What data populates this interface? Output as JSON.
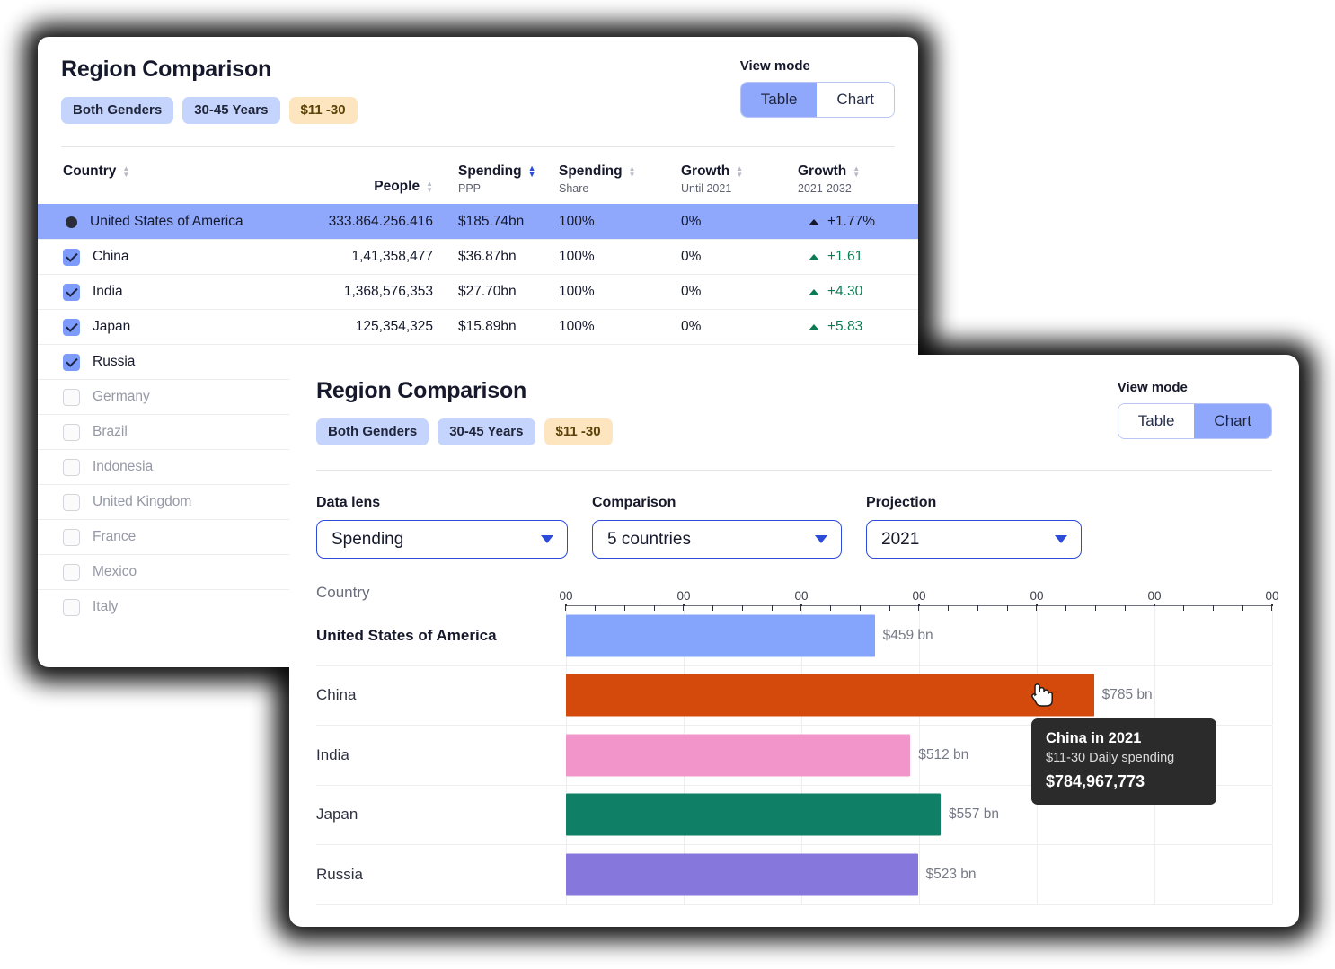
{
  "back_card": {
    "title": "Region Comparison",
    "chips": [
      {
        "label": "Both Genders",
        "style": "blue"
      },
      {
        "label": "30-45 Years",
        "style": "blue"
      },
      {
        "label": "$11 -30",
        "style": "amber"
      }
    ],
    "view_mode": {
      "label": "View mode",
      "options": [
        "Table",
        "Chart"
      ],
      "active": "Table"
    },
    "table": {
      "columns": [
        {
          "title": "Country",
          "sub": "",
          "sorted": false
        },
        {
          "title": "People",
          "sub": "",
          "sorted": false
        },
        {
          "title": "Spending",
          "sub": "PPP",
          "sorted": true
        },
        {
          "title": "Spending",
          "sub": "Share",
          "sorted": false
        },
        {
          "title": "Growth",
          "sub": "Until 2021",
          "sorted": false
        },
        {
          "title": "Growth",
          "sub": "2021-2032",
          "sorted": false
        }
      ],
      "rows": [
        {
          "country": "United States of America",
          "people": "333.864.256.416",
          "spending_ppp": "$185.74bn",
          "spending_share": "100%",
          "growth_until": "0%",
          "growth_future": "+1.77%",
          "state": "selected",
          "marker": "dot"
        },
        {
          "country": "China",
          "people": "1,41,358,477",
          "spending_ppp": "$36.87bn",
          "spending_share": "100%",
          "growth_until": "0%",
          "growth_future": "+1.61",
          "state": "checked",
          "marker": "checkbox-on"
        },
        {
          "country": "India",
          "people": "1,368,576,353",
          "spending_ppp": "$27.70bn",
          "spending_share": "100%",
          "growth_until": "0%",
          "growth_future": "+4.30",
          "state": "checked",
          "marker": "checkbox-on"
        },
        {
          "country": "Japan",
          "people": "125,354,325",
          "spending_ppp": "$15.89bn",
          "spending_share": "100%",
          "growth_until": "0%",
          "growth_future": "+5.83",
          "state": "checked",
          "marker": "checkbox-on"
        },
        {
          "country": "Russia",
          "people": "",
          "spending_ppp": "",
          "spending_share": "",
          "growth_until": "",
          "growth_future": "",
          "state": "checked",
          "marker": "checkbox-on"
        },
        {
          "country": "Germany",
          "people": "",
          "spending_ppp": "",
          "spending_share": "",
          "growth_until": "",
          "growth_future": "",
          "state": "unchecked",
          "marker": "checkbox-off"
        },
        {
          "country": "Brazil",
          "people": "",
          "spending_ppp": "",
          "spending_share": "",
          "growth_until": "",
          "growth_future": "",
          "state": "unchecked",
          "marker": "checkbox-off"
        },
        {
          "country": "Indonesia",
          "people": "",
          "spending_ppp": "",
          "spending_share": "",
          "growth_until": "",
          "growth_future": "",
          "state": "unchecked",
          "marker": "checkbox-off"
        },
        {
          "country": "United Kingdom",
          "people": "",
          "spending_ppp": "",
          "spending_share": "",
          "growth_until": "",
          "growth_future": "",
          "state": "unchecked",
          "marker": "checkbox-off"
        },
        {
          "country": "France",
          "people": "",
          "spending_ppp": "",
          "spending_share": "",
          "growth_until": "",
          "growth_future": "",
          "state": "unchecked",
          "marker": "checkbox-off"
        },
        {
          "country": "Mexico",
          "people": "",
          "spending_ppp": "",
          "spending_share": "",
          "growth_until": "",
          "growth_future": "",
          "state": "unchecked",
          "marker": "checkbox-off"
        },
        {
          "country": "Italy",
          "people": "",
          "spending_ppp": "",
          "spending_share": "",
          "growth_until": "",
          "growth_future": "",
          "state": "unchecked",
          "marker": "checkbox-off"
        }
      ]
    }
  },
  "front_card": {
    "title": "Region Comparison",
    "chips": [
      {
        "label": "Both Genders",
        "style": "blue"
      },
      {
        "label": "30-45 Years",
        "style": "blue"
      },
      {
        "label": "$11 -30",
        "style": "amber"
      }
    ],
    "view_mode": {
      "label": "View mode",
      "options": [
        "Table",
        "Chart"
      ],
      "active": "Chart"
    },
    "controls": [
      {
        "label": "Data lens",
        "value": "Spending"
      },
      {
        "label": "Comparison",
        "value": "5 countries"
      },
      {
        "label": "Projection",
        "value": "2021"
      }
    ],
    "tooltip": {
      "title": "China in 2021",
      "subtitle": "$11-30 Daily spending",
      "value": "$784,967,773"
    }
  },
  "chart_data": {
    "type": "bar",
    "orientation": "horizontal",
    "title": "",
    "xlabel": "",
    "ylabel": "Country",
    "axis_label": "Country",
    "tick_labels": [
      "00",
      "00",
      "00",
      "00",
      "00",
      "00",
      "00"
    ],
    "grid": true,
    "legend": "none",
    "xlim": [
      0,
      1050
    ],
    "categories": [
      "United States of America",
      "China",
      "India",
      "Japan",
      "Russia"
    ],
    "values": [
      459,
      785,
      512,
      557,
      523
    ],
    "value_labels": [
      "$459 bn",
      "$785 bn",
      "$512 bn",
      "$557 bn",
      "$523 bn"
    ],
    "colors": [
      "#85a4fb",
      "#d4490c",
      "#f295ca",
      "#0f8066",
      "#8677dc"
    ],
    "units": "bn",
    "highlighted": "China"
  },
  "colors": {
    "accent_blue": "#8fa8fb",
    "chip_blue": "#c5d4fd",
    "chip_amber": "#fde6bf",
    "select_border": "#2c4bd8",
    "growth_green": "#0c7a52",
    "tooltip_bg": "#2b2b2b"
  }
}
